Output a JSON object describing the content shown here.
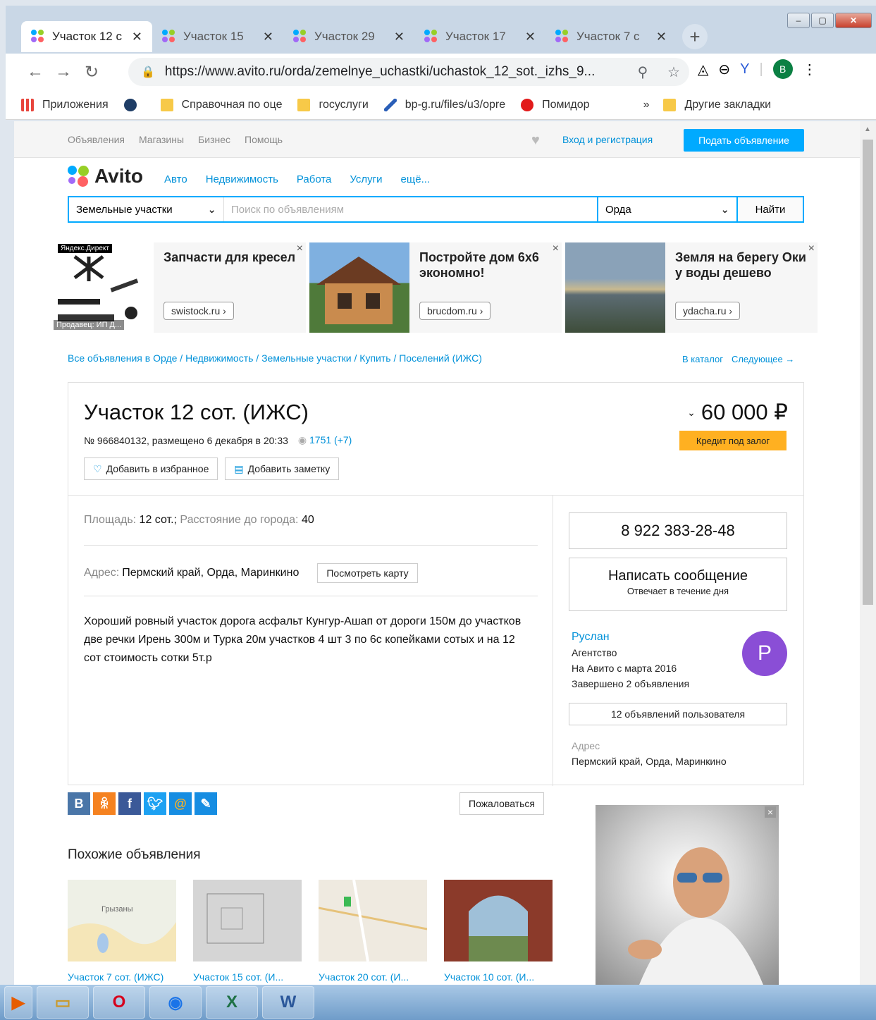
{
  "browser": {
    "tabs": [
      {
        "label": "Участок 12 с",
        "active": true
      },
      {
        "label": "Участок 15",
        "active": false
      },
      {
        "label": "Участок 29",
        "active": false
      },
      {
        "label": "Участок 17",
        "active": false
      },
      {
        "label": "Участок 7 с",
        "active": false
      }
    ],
    "url": "https://www.avito.ru/orda/zemelnye_uchastki/uchastok_12_sot._izhs_9...",
    "profile_initial": "B",
    "bookmarks": [
      {
        "label": "Приложения",
        "icon": "apps-icon"
      },
      {
        "label": "",
        "icon": "extension-icon"
      },
      {
        "label": "Справочная по оце",
        "icon": "folder-icon"
      },
      {
        "label": "госуслуги",
        "icon": "folder-icon"
      },
      {
        "label": "bp-g.ru/files/u3/opre",
        "icon": "quill-icon"
      },
      {
        "label": "Помидор",
        "icon": "tomato-icon"
      }
    ],
    "bookmarks_more": "»",
    "other_bookmarks": "Другие закладки"
  },
  "site": {
    "topnav": [
      "Объявления",
      "Магазины",
      "Бизнес",
      "Помощь"
    ],
    "login": "Вход и регистрация",
    "post_ad": "Подать объявление",
    "logo": "Avito",
    "categories": [
      "Авто",
      "Недвижимость",
      "Работа",
      "Услуги",
      "ещё..."
    ],
    "search": {
      "category": "Земельные участки",
      "placeholder": "Поиск по объявлениям",
      "location": "Орда",
      "button": "Найти"
    }
  },
  "ads": [
    {
      "title": "Запчасти для кресел",
      "domain": "swistock.ru ›",
      "badge": "Яндекс.Директ",
      "seller": "Продавец: ИП Д..."
    },
    {
      "title": "Постройте дом 6х6 экономно!",
      "domain": "brucdom.ru ›"
    },
    {
      "title": "Земля на берегу Оки у воды дешево",
      "domain": "ydacha.ru ›"
    }
  ],
  "breadcrumbs": "Все объявления в Орде / Недвижимость / Земельные участки / Купить / Поселений (ИЖС)",
  "catalog_links": {
    "catalog": "В каталог",
    "next": "Следующее →"
  },
  "listing": {
    "title": "Участок 12 сот. (ИЖС)",
    "meta": "№ 966840132, размещено 6 декабря в 20:33",
    "views": "1751 (+7)",
    "fav_button": "Добавить в избранное",
    "note_button": "Добавить заметку",
    "price": "60 000 ₽",
    "credit": "Кредит под залог",
    "area_label": "Площадь:",
    "area_value": "12 сот.;",
    "distance_label": "Расстояние до города:",
    "distance_value": "40",
    "address_label": "Адрес:",
    "address_value": "Пермский край, Орда, Маринкино",
    "map_button": "Посмотреть карту",
    "description": "Хороший ровный участок дорога асфальт Кунгур-Ашап от дороги 150м до участков две речки Ирень 300м и Турка 20м участков 4 шт 3 по 6с копейками сотых и на 12 сот стоимость сотки 5т.р"
  },
  "contact": {
    "phone": "8 922 383-28-48",
    "message_title": "Написать сообщение",
    "message_sub": "Отвечает в течение дня",
    "seller_name": "Руслан",
    "seller_type": "Агентство",
    "since": "На Авито с марта 2016",
    "completed": "Завершено 2 объявления",
    "avatar_initial": "P",
    "user_ads": "12 объявлений пользователя",
    "address_label": "Адрес",
    "address": "Пермский край, Орда, Маринкино"
  },
  "share_icons": [
    "В",
    "ok",
    "f",
    "t",
    "@",
    "bm"
  ],
  "complain": "Пожаловаться",
  "similar_heading": "Похожие объявления",
  "similar": [
    {
      "label": "Участок 7 сот. (ИЖС)",
      "map_text": "Грызаны"
    },
    {
      "label": "Участок 15 сот. (И..."
    },
    {
      "label": "Участок 20 сот. (И..."
    },
    {
      "label": "Участок 10 сот. (И..."
    }
  ],
  "colors": {
    "accent": "#00aaff",
    "link": "#0091d9",
    "credit": "#ffb021",
    "avatar": "#8a4ed6"
  }
}
